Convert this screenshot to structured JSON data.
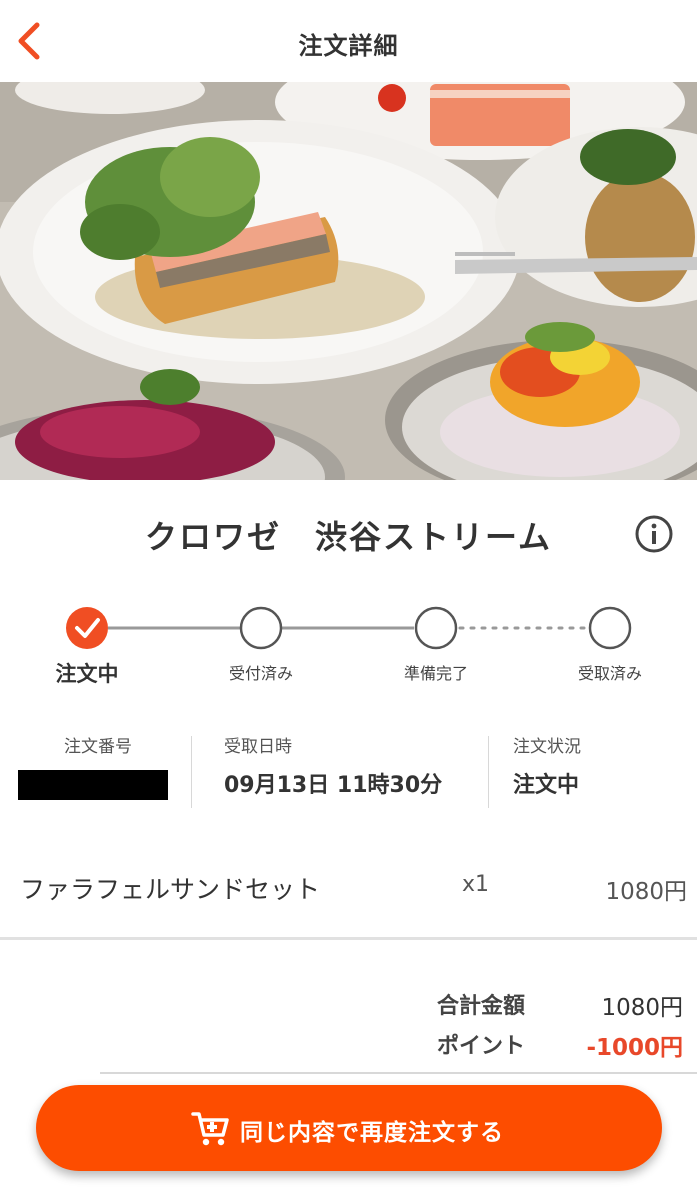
{
  "header": {
    "title": "注文詳細",
    "back_icon": "chevron-left-icon",
    "accent": "#f04e23"
  },
  "hero": {
    "image": "food-photo",
    "description_icon": "photo"
  },
  "store": {
    "name": "クロワゼ　渋谷ストリーム",
    "info_icon": "info-icon"
  },
  "steps": [
    {
      "label": "注文中",
      "state": "done"
    },
    {
      "label": "受付済み",
      "state": "pending"
    },
    {
      "label": "準備完了",
      "state": "pending"
    },
    {
      "label": "受取済み",
      "state": "pending"
    }
  ],
  "order_meta": {
    "number_label": "注文番号",
    "pickup_label": "受取日時",
    "pickup_value": "09月13日 11時30分",
    "status_label": "注文状況",
    "status_value": "注文中"
  },
  "items": [
    {
      "name": "ファラフェルサンドセット",
      "qty": "x1",
      "price": "1080円"
    }
  ],
  "totals": {
    "subtotal_label": "合計金額",
    "subtotal_value": "1080円",
    "points_label": "ポイント",
    "points_value": "-1000円"
  },
  "reorder": {
    "label": "同じ内容で再度注文する",
    "icon": "cart-icon",
    "color": "#fd4d00"
  }
}
